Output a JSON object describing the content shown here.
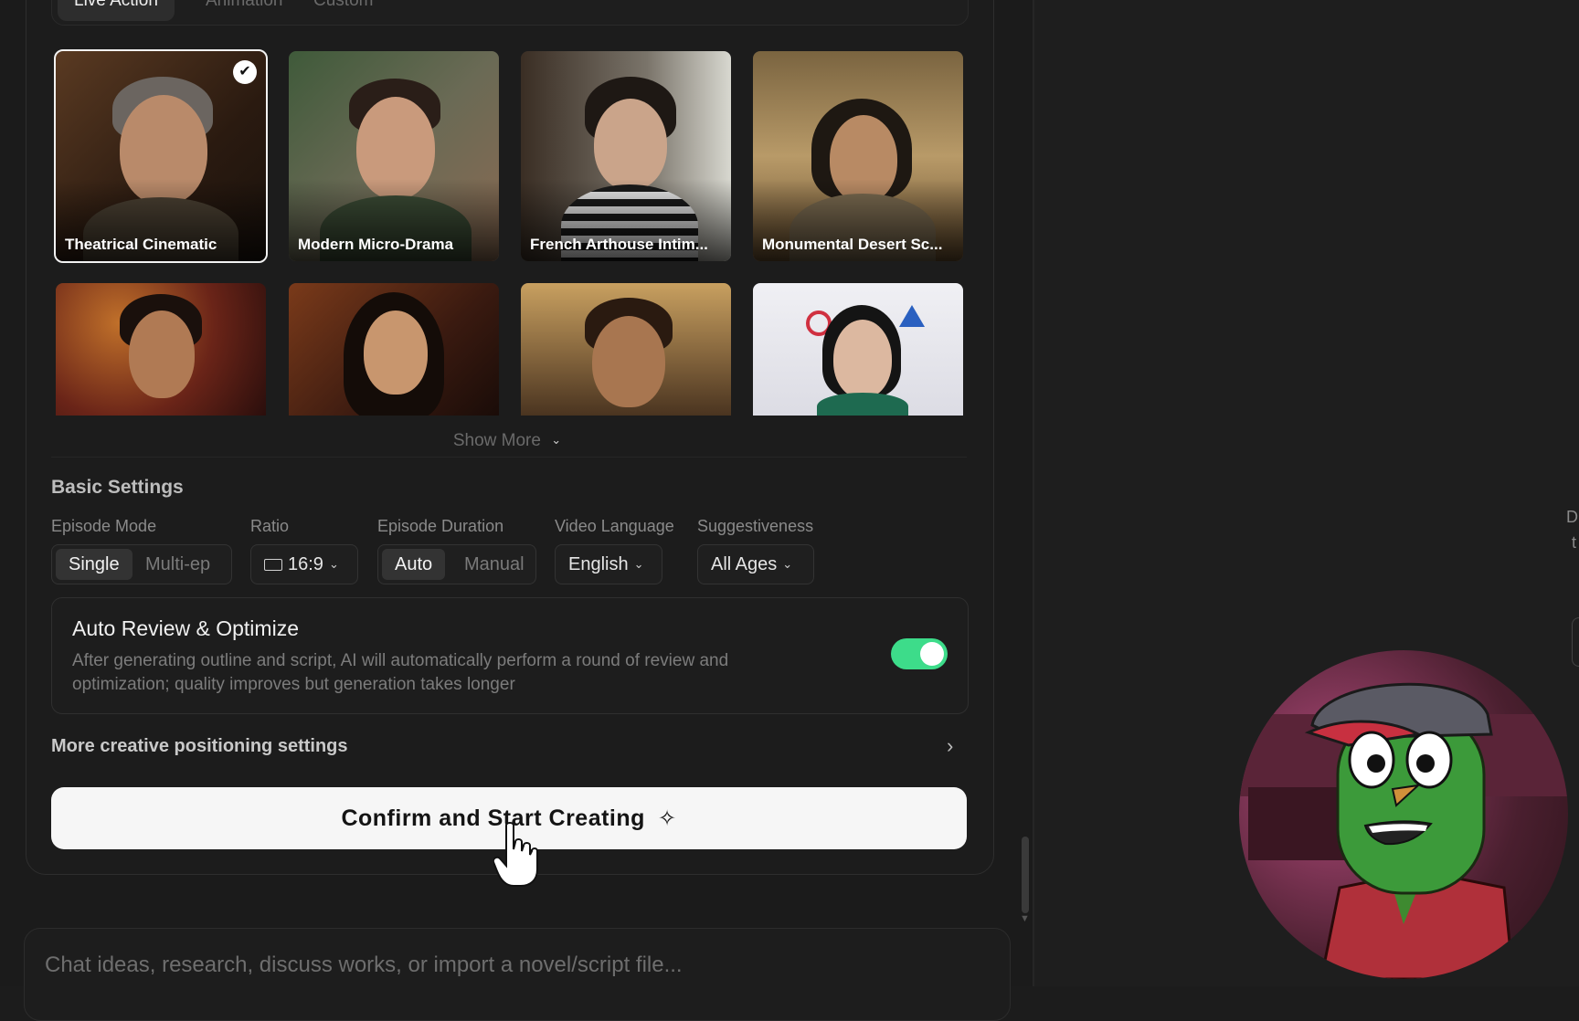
{
  "tabs": [
    {
      "label": "Live Action"
    },
    {
      "label": "Animation"
    },
    {
      "label": "Custom"
    }
  ],
  "styles": [
    {
      "label": "Theatrical Cinematic",
      "selected": true
    },
    {
      "label": "Modern Micro-Drama",
      "selected": false
    },
    {
      "label": "French Arthouse Intim...",
      "selected": false
    },
    {
      "label": "Monumental Desert Sc...",
      "selected": false
    }
  ],
  "check_mark": "✔",
  "show_more": {
    "label": "Show More",
    "icon": "chevron-down-icon"
  },
  "basic_settings": {
    "title": "Basic Settings",
    "episode_mode": {
      "label": "Episode Mode",
      "options": [
        "Single",
        "Multi-ep"
      ],
      "selected": "Single"
    },
    "ratio": {
      "label": "Ratio",
      "value": "16:9"
    },
    "episode_duration": {
      "label": "Episode Duration",
      "options": [
        "Auto",
        "Manual"
      ],
      "selected": "Auto"
    },
    "video_language": {
      "label": "Video Language",
      "value": "English"
    },
    "suggestiveness": {
      "label": "Suggestiveness",
      "value": "All Ages"
    }
  },
  "auto_review": {
    "title": "Auto Review & Optimize",
    "description": "After generating outline and script, AI will automatically perform a round of review and optimization; quality improves but generation takes longer",
    "enabled": true,
    "toggle_color": "#3ddc8a"
  },
  "more_settings": {
    "label": "More creative positioning settings"
  },
  "cta": {
    "label": "Confirm and Start Creating",
    "icon": "sparkle-icon"
  },
  "chat": {
    "placeholder": "Chat ideas, research, discuss works, or import a novel/script file..."
  },
  "right_edge": {
    "text_top": "D",
    "text_bottom": "t"
  }
}
